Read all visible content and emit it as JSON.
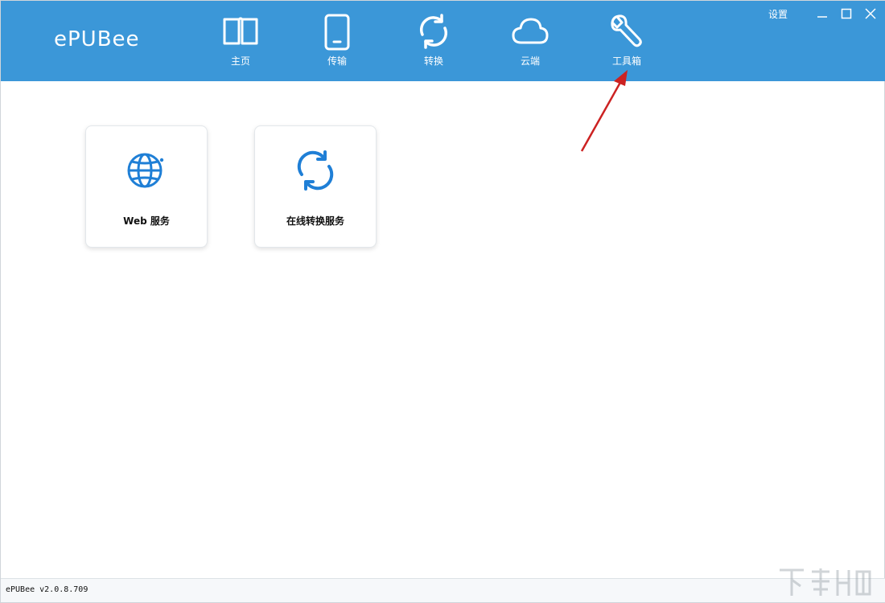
{
  "app": {
    "logo": "ePUBee",
    "version": "ePUBee v2.0.8.709"
  },
  "nav": [
    {
      "id": "home",
      "label": "主页",
      "icon": "book-icon"
    },
    {
      "id": "transfer",
      "label": "传输",
      "icon": "phone-icon"
    },
    {
      "id": "convert",
      "label": "转换",
      "icon": "refresh-icon"
    },
    {
      "id": "cloud",
      "label": "云端",
      "icon": "cloud-icon"
    },
    {
      "id": "toolbox",
      "label": "工具箱",
      "icon": "wrench-icon",
      "active": true
    }
  ],
  "window_controls": {
    "settings": "设置",
    "minimize": "minimize-icon",
    "maximize": "maximize-icon",
    "close": "close-icon"
  },
  "tools": [
    {
      "label": "Web 服务",
      "icon": "globe-icon"
    },
    {
      "label": "在线转换服务",
      "icon": "refresh-icon"
    }
  ],
  "colors": {
    "header": "#3b97d8",
    "accent_icon": "#1f7fd6",
    "annotation_arrow": "#cc2222"
  }
}
